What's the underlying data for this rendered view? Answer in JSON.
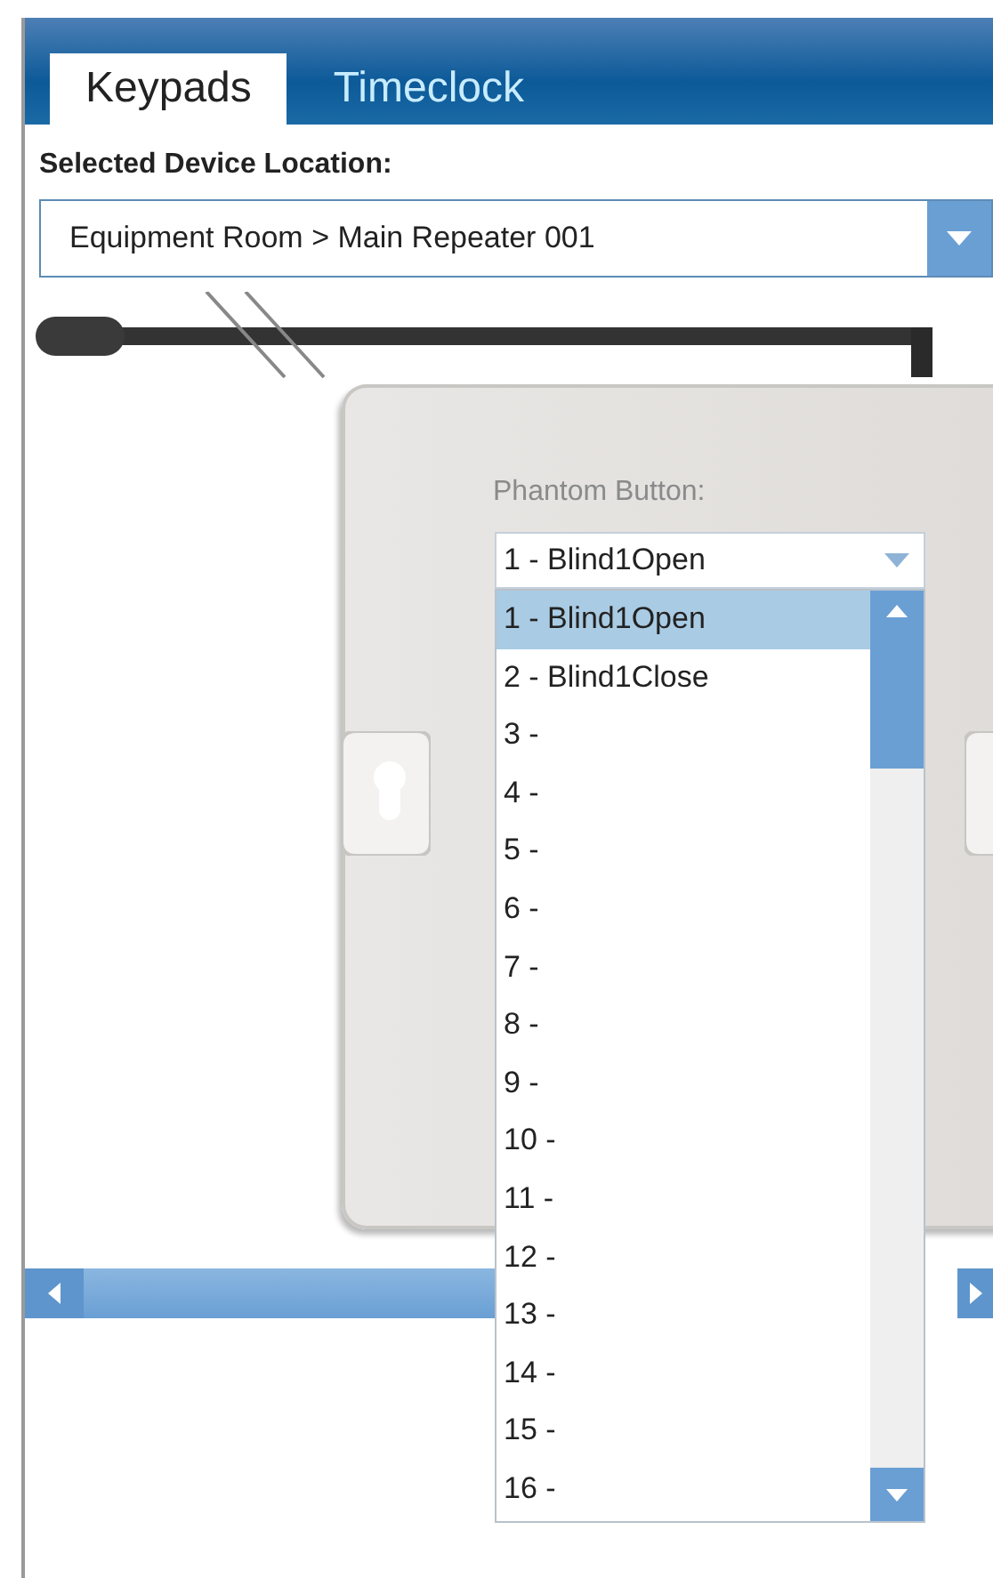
{
  "tabs": [
    {
      "label": "Keypads",
      "selected": true
    },
    {
      "label": "Timeclock",
      "selected": false
    }
  ],
  "location": {
    "label": "Selected Device Location:",
    "value": "Equipment Room > Main Repeater 001"
  },
  "phantom_button": {
    "label": "Phantom Button:",
    "value": "1 - Blind1Open",
    "options": [
      {
        "label": "1 - Blind1Open",
        "selected": true
      },
      {
        "label": "2 - Blind1Close",
        "selected": false
      },
      {
        "label": "3 -",
        "selected": false
      },
      {
        "label": "4 -",
        "selected": false
      },
      {
        "label": "5 -",
        "selected": false
      },
      {
        "label": "6 -",
        "selected": false
      },
      {
        "label": "7 -",
        "selected": false
      },
      {
        "label": "8 -",
        "selected": false
      },
      {
        "label": "9 -",
        "selected": false
      },
      {
        "label": "10 -",
        "selected": false
      },
      {
        "label": "11 -",
        "selected": false
      },
      {
        "label": "12 -",
        "selected": false
      },
      {
        "label": "13 -",
        "selected": false
      },
      {
        "label": "14 -",
        "selected": false
      },
      {
        "label": "15 -",
        "selected": false
      },
      {
        "label": "16 -",
        "selected": false
      }
    ]
  }
}
